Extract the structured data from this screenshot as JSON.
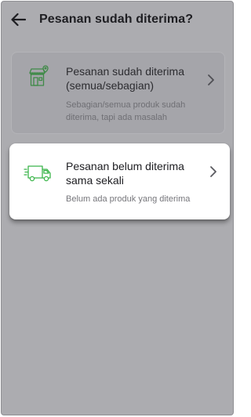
{
  "header": {
    "title": "Pesanan sudah diterima?"
  },
  "options": [
    {
      "title_line1": "Pesanan sudah diterima",
      "title_line2": "(semua/sebagian)",
      "desc_line1": "Sebagian/semua produk sudah",
      "desc_line2": "diterima, tapi ada masalah",
      "icon": "store-icon",
      "state": "disabled"
    },
    {
      "title_line1": "Pesanan belum diterima",
      "title_line2": "sama sekali",
      "desc_line1": "Belum ada produk yang diterima",
      "icon": "delivery-truck-icon",
      "state": "highlighted"
    }
  ],
  "colors": {
    "accent": "#3bb54a",
    "overlay": "#acacb0"
  }
}
